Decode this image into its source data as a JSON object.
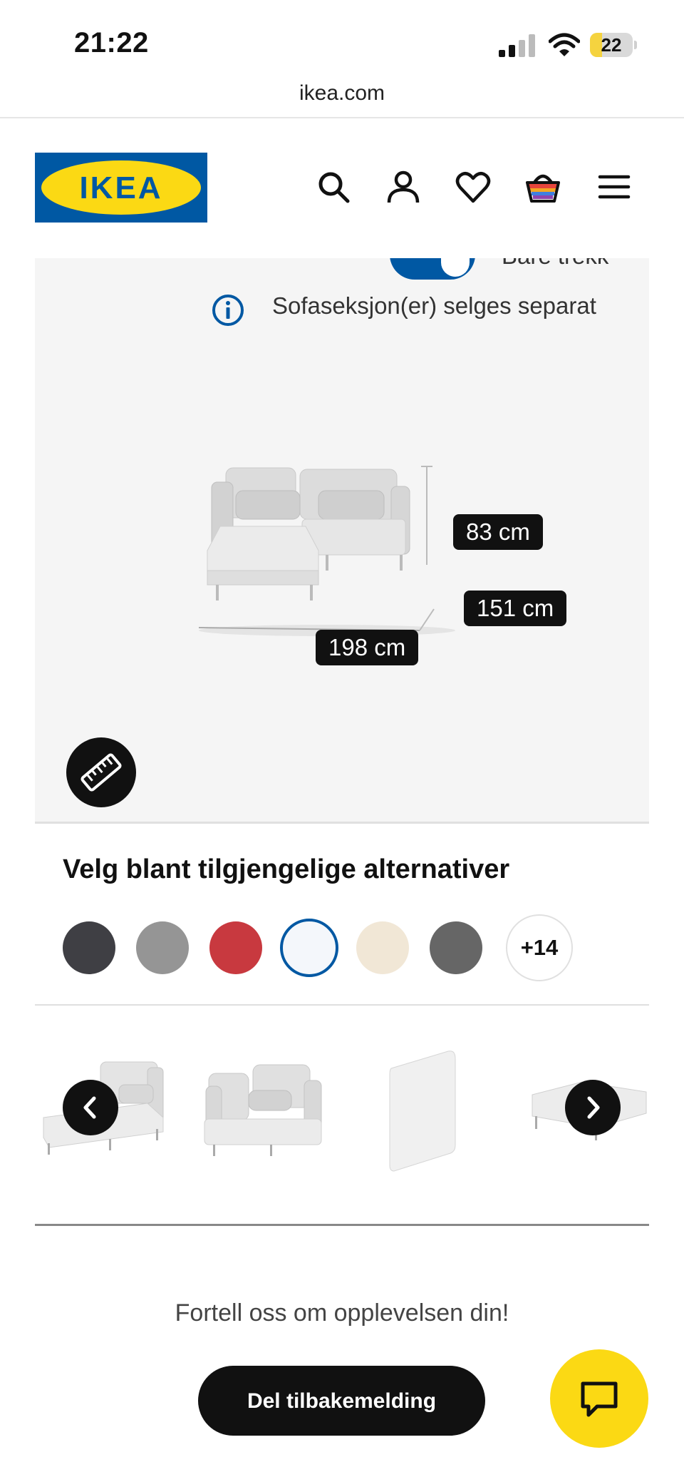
{
  "status_bar": {
    "time": "21:22",
    "battery": "22"
  },
  "browser": {
    "url": "ikea.com"
  },
  "header": {
    "logo_text": "IKEA",
    "icons": [
      "search-icon",
      "account-icon",
      "heart-icon",
      "basket-icon",
      "menu-icon"
    ]
  },
  "product_view": {
    "toggle_label": "Bare trekk",
    "info_text": "Sofaseksjon(er) selges separat",
    "dimensions": {
      "height": "83 cm",
      "depth": "151 cm",
      "width": "198 cm"
    }
  },
  "variants": {
    "title": "Velg blant tilgjengelige alternativer",
    "swatches": [
      "#3f3f44",
      "#959595",
      "#c8393f",
      "#f4f7fb",
      "#f1e7d6",
      "#666666"
    ],
    "selected_index": 3,
    "more_label": "+14"
  },
  "feedback": {
    "prompt": "Fortell oss om opplevelsen din!",
    "button_label": "Del tilbakemelding"
  },
  "colors": {
    "ikea_blue": "#0058a3",
    "ikea_yellow": "#fbd914"
  }
}
